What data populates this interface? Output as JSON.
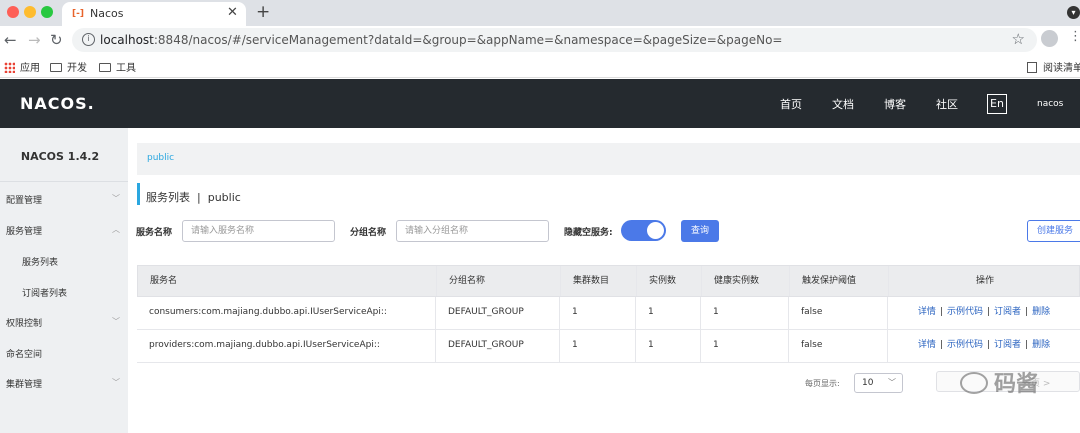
{
  "browser": {
    "tab_title": "Nacos",
    "tab_favicon": "[-]",
    "url_host": "localhost",
    "url_rest": ":8848/nacos/#/serviceManagement?dataId=&group=&appName=&namespace=&pageSize=&pageNo=",
    "bookmarks": [
      "应用",
      "开发",
      "工具"
    ],
    "reading_list": "阅读清单"
  },
  "header": {
    "logo": "NACOS.",
    "links": [
      "首页",
      "文档",
      "博客",
      "社区"
    ],
    "lang": "En",
    "username": "nacos"
  },
  "sidebar": {
    "version": "NACOS 1.4.2",
    "items": [
      {
        "label": "配置管理",
        "chevron": "down"
      },
      {
        "label": "服务管理",
        "chevron": "up"
      },
      {
        "label": "服务列表"
      },
      {
        "label": "订阅者列表"
      },
      {
        "label": "权限控制",
        "chevron": "down"
      },
      {
        "label": "命名空间"
      },
      {
        "label": "集群管理",
        "chevron": "down"
      }
    ]
  },
  "main": {
    "breadcrumb": "public",
    "title": "服务列表",
    "title_sep": "|",
    "title_ns": "public",
    "filters": {
      "service_label": "服务名称",
      "service_placeholder": "请输入服务名称",
      "group_label": "分组名称",
      "group_placeholder": "请输入分组名称",
      "hide_empty_label": "隐藏空服务:",
      "hide_empty_on": true,
      "query_label": "查询",
      "create_label": "创建服务"
    },
    "table": {
      "headers": [
        "服务名",
        "分组名称",
        "集群数目",
        "实例数",
        "健康实例数",
        "触发保护阈值",
        "操作"
      ],
      "rows": [
        [
          "consumers:com.majiang.dubbo.api.IUserServiceApi::",
          "DEFAULT_GROUP",
          "1",
          "1",
          "1",
          "false"
        ],
        [
          "providers:com.majiang.dubbo.api.IUserServiceApi::",
          "DEFAULT_GROUP",
          "1",
          "1",
          "1",
          "false"
        ]
      ],
      "ops": [
        "详情",
        "示例代码",
        "订阅者",
        "删除"
      ],
      "op_sep": "|"
    },
    "pagination": {
      "page_size_label": "每页显示:",
      "page_size": "10",
      "next_label": "一页 >"
    }
  },
  "watermark": "码酱",
  "colors": {
    "primary": "#4b79e8",
    "link": "#2aa7e0",
    "header_bg": "#252a2f"
  }
}
